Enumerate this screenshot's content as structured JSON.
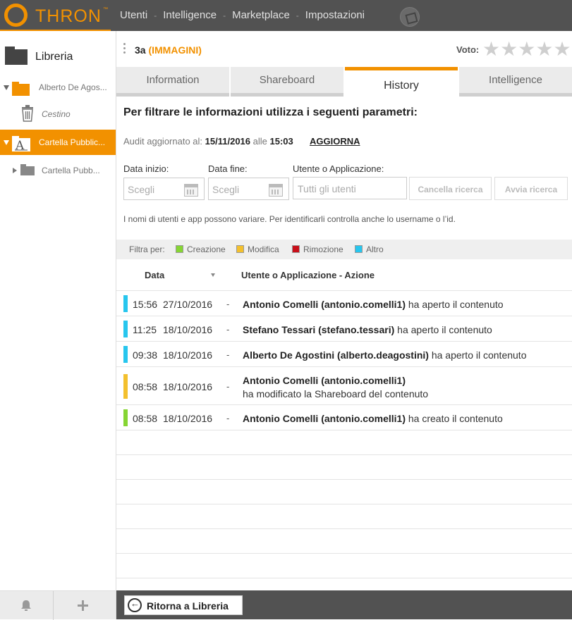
{
  "brand": {
    "name": "THRON",
    "tm": "™",
    "accent": "#f29100"
  },
  "nav": {
    "items": [
      "Utenti",
      "Intelligence",
      "Marketplace",
      "Impostazioni"
    ],
    "separator": "-"
  },
  "sidebar": {
    "title": "Libreria",
    "items": [
      {
        "label": "Alberto De Agos..."
      },
      {
        "label": "Cestino"
      },
      {
        "label": "Cartella Pubblic..."
      },
      {
        "label": "Cartella Pubb..."
      }
    ]
  },
  "content": {
    "title": "3a",
    "title_sub": "(IMMAGINI)",
    "vote_label": "Voto:",
    "rating": 0,
    "stars_max": 5
  },
  "tabs": [
    "Information",
    "Shareboard",
    "History",
    "Intelligence"
  ],
  "active_tab": "History",
  "history": {
    "heading": "Per filtrare le informazioni utilizza i seguenti parametri:",
    "audit_prefix": "Audit aggiornato al:",
    "audit_date": "15/11/2016",
    "audit_mid": "alle",
    "audit_time": "15:03",
    "refresh_label": "AGGIORNA",
    "start_label": "Data inizio:",
    "end_label": "Data fine:",
    "user_label": "Utente o Applicazione:",
    "date_placeholder": "Scegli",
    "user_placeholder": "Tutti gli utenti",
    "clear_button": "Cancella ricerca",
    "search_button": "Avvia ricerca",
    "note": "I nomi di utenti e app possono variare. Per identificarli controlla anche lo username o l’id.",
    "filter_label": "Filtra per:",
    "filters": [
      {
        "label": "Creazione",
        "color": "#86d533"
      },
      {
        "label": "Modifica",
        "color": "#f3c02d"
      },
      {
        "label": "Rimozione",
        "color": "#c80f1a"
      },
      {
        "label": "Altro",
        "color": "#27c6ee"
      }
    ],
    "col_date": "Data",
    "col_action": "Utente o Applicazione - Azione",
    "dash": "-",
    "entries": [
      {
        "time": "15:56",
        "date": "27/10/2016",
        "user": "Antonio Comelli (antonio.comelli1)",
        "action": "ha aperto il contenuto",
        "color": "#27c6ee"
      },
      {
        "time": "11:25",
        "date": "18/10/2016",
        "user": "Stefano Tessari (stefano.tessari)",
        "action": "ha aperto il contenuto",
        "color": "#27c6ee"
      },
      {
        "time": "09:38",
        "date": "18/10/2016",
        "user": "Alberto De Agostini (alberto.deagostini)",
        "action": "ha aperto il contenuto",
        "color": "#27c6ee"
      },
      {
        "time": "08:58",
        "date": "18/10/2016",
        "user": "Antonio Comelli (antonio.comelli1)",
        "action": "ha modificato la Shareboard del contenuto",
        "color": "#f3c02d"
      },
      {
        "time": "08:58",
        "date": "18/10/2016",
        "user": "Antonio Comelli (antonio.comelli1)",
        "action": "ha creato il contenuto",
        "color": "#86d533"
      }
    ]
  },
  "footer": {
    "back_label": "Ritorna a Libreria"
  }
}
